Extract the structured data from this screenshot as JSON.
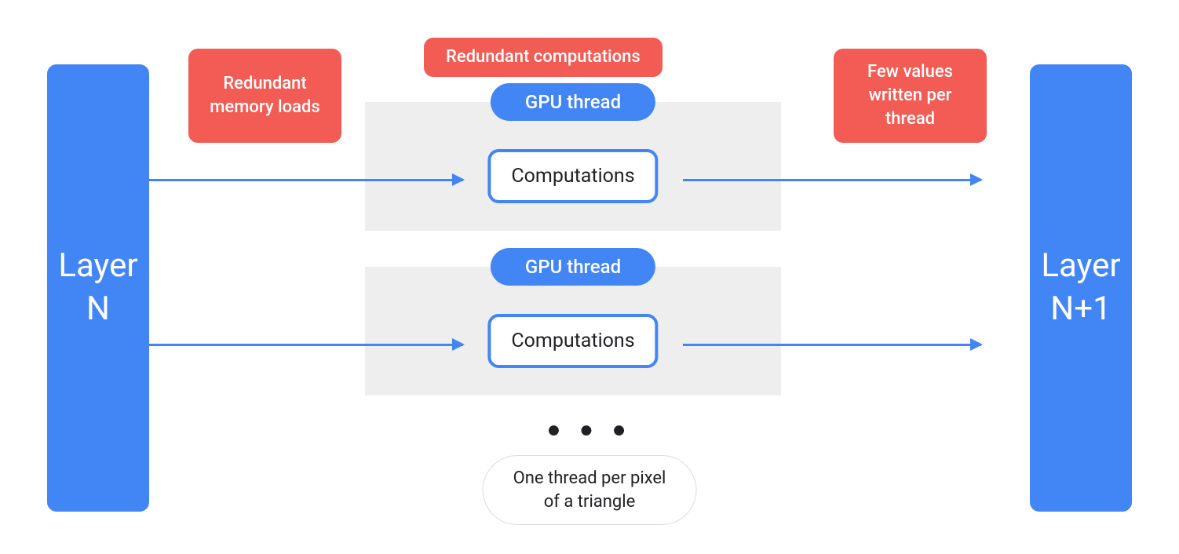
{
  "colors": {
    "blue": "#4285f4",
    "red": "#f25c54",
    "gray_bg": "#eeeeee",
    "text_dark": "#202124"
  },
  "layer_n": "Layer\nN",
  "layer_n1": "Layer\nN+1",
  "annotations": {
    "redundant_memory": "Redundant memory loads",
    "redundant_comp": "Redundant computations",
    "few_values": "Few values written per thread"
  },
  "threads": [
    {
      "label": "GPU thread",
      "box": "Computations"
    },
    {
      "label": "GPU thread",
      "box": "Computations"
    }
  ],
  "ellipsis": "● ● ●",
  "caption": "One thread per pixel\nof a triangle"
}
